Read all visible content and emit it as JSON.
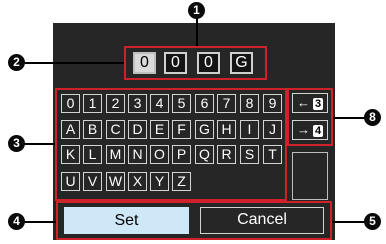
{
  "callouts": [
    "1",
    "2",
    "3",
    "4",
    "5",
    "8"
  ],
  "id_field": [
    "0",
    "0",
    "0",
    "G"
  ],
  "keyboard": {
    "rows": [
      [
        "0",
        "1",
        "2",
        "3",
        "4",
        "5",
        "6",
        "7",
        "8",
        "9"
      ],
      [
        "A",
        "B",
        "C",
        "D",
        "E",
        "F",
        "G",
        "H",
        "I",
        "J"
      ],
      [
        "K",
        "L",
        "M",
        "N",
        "O",
        "P",
        "Q",
        "R",
        "S",
        "T"
      ],
      [
        "U",
        "V",
        "W",
        "X",
        "Y",
        "Z"
      ]
    ]
  },
  "nav_keys": [
    {
      "arrow": "←",
      "badge": "3"
    },
    {
      "arrow": "→",
      "badge": "4"
    }
  ],
  "actions": {
    "set_label": "Set",
    "cancel_label": "Cancel"
  },
  "colors": {
    "highlight": "#d0202a",
    "screen": "#262626",
    "set_button": "#cfe8f7"
  }
}
